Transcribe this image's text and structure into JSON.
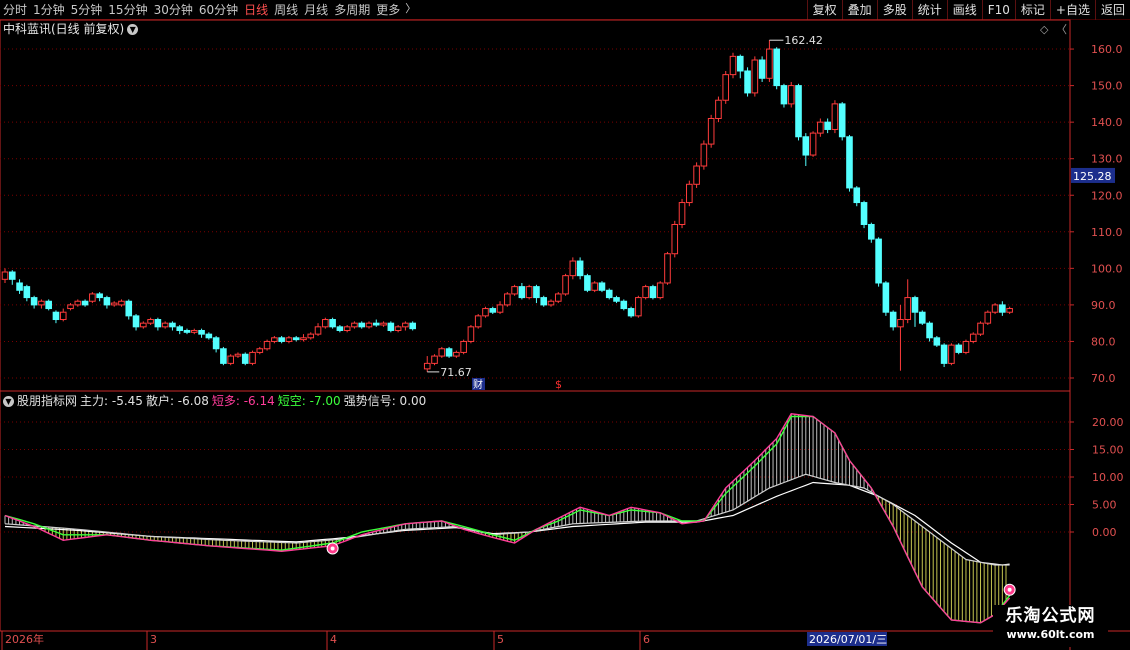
{
  "toolbar": {
    "periods": [
      "分时",
      "1分钟",
      "5分钟",
      "15分钟",
      "30分钟",
      "60分钟",
      "日线",
      "周线",
      "月线",
      "多周期",
      "更多"
    ],
    "active_period": "日线",
    "buttons": [
      "复权",
      "叠加",
      "多股",
      "统计",
      "画线",
      "F10",
      "标记",
      "+自选",
      "返回"
    ]
  },
  "main_panel": {
    "stock_title": "中科蓝讯(日线 前复权)",
    "y_ticks": [
      "160.0",
      "150.0",
      "140.0",
      "130.0",
      "120.0",
      "110.0",
      "100.0",
      "90.0",
      "80.0",
      "70.0"
    ],
    "current_price": "125.28",
    "high_label": "162.42",
    "low_label": "71.67",
    "marker_cai": "财",
    "marker_s": "$"
  },
  "indicator_panel": {
    "name": "股朋指标网",
    "zhuli": "主力: -5.45",
    "sanhu": "散户: -6.08",
    "duanduo": "短多: -6.14",
    "duankong": "短空: -7.00",
    "qiangshi": "强势信号: 0.00",
    "y_ticks": [
      "20.00",
      "15.00",
      "10.00",
      "5.00",
      "0.00"
    ]
  },
  "x_axis": {
    "labels": [
      "2026年",
      "3",
      "4",
      "5",
      "6"
    ],
    "cursor_date": "2026/07/01/三"
  },
  "colors": {
    "up": "#ff3c3c",
    "down": "#54ffff",
    "grid": "#7a0000",
    "axis": "#c82828",
    "duanduo": "#ff3c9a",
    "duankong": "#3cff3c",
    "price_tag_bg": "#1c2e8c"
  },
  "watermark": {
    "line1": "乐淘公式网",
    "line2": "www.60lt.com"
  }
}
